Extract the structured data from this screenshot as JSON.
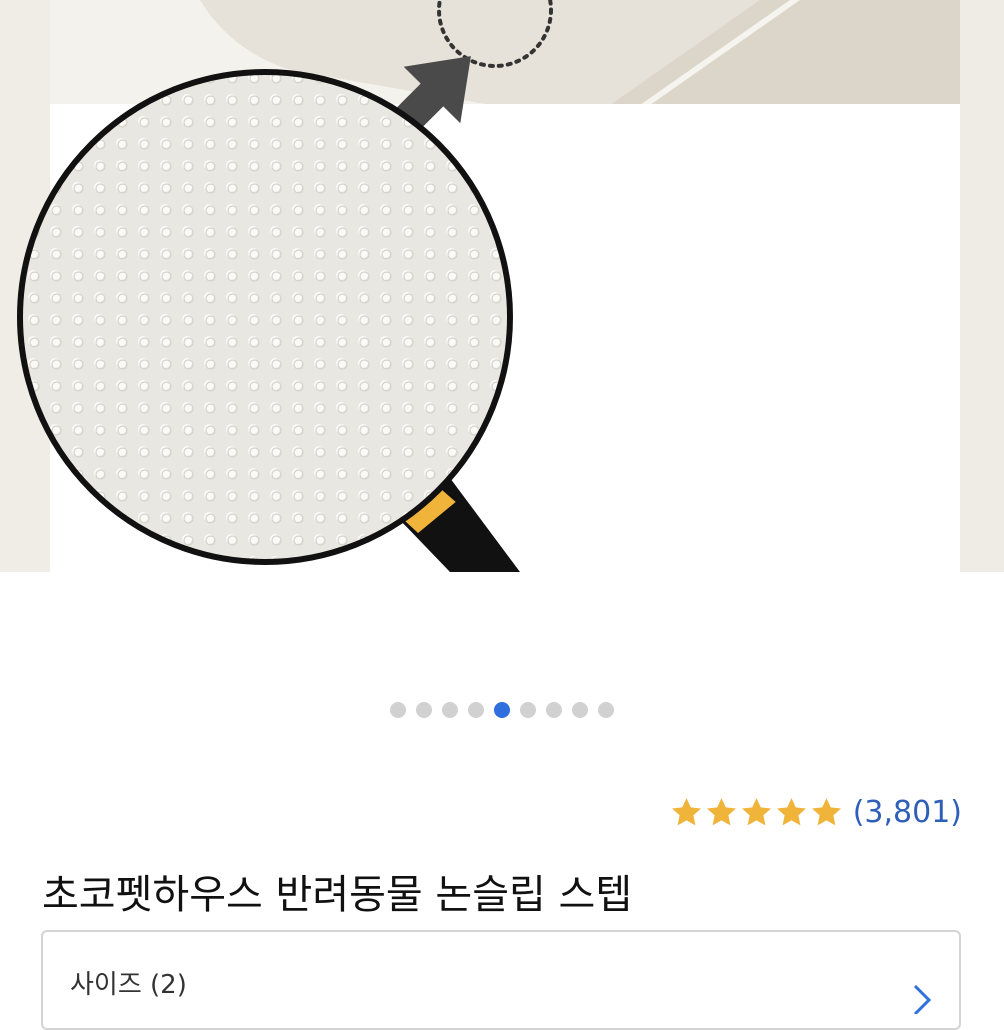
{
  "gallery": {
    "image_icon": "product-image-magnifier-nonslip-texture",
    "slide_count": 9,
    "active_index": 4
  },
  "rating": {
    "stars": 5,
    "star_color": "#f0b43a",
    "count_text": "(3,801)",
    "count_color": "#2f5fb8"
  },
  "product": {
    "title": "초코펫하우스 반려동물 논슬립 스텝"
  },
  "option": {
    "label": "사이즈 (2)",
    "chevron_icon": "chevron-right-icon",
    "chevron_color": "#2f6fde"
  },
  "colors": {
    "dot_inactive": "#d1d1d1",
    "dot_active": "#2f6fde",
    "handle_band": "#f0b43a"
  }
}
